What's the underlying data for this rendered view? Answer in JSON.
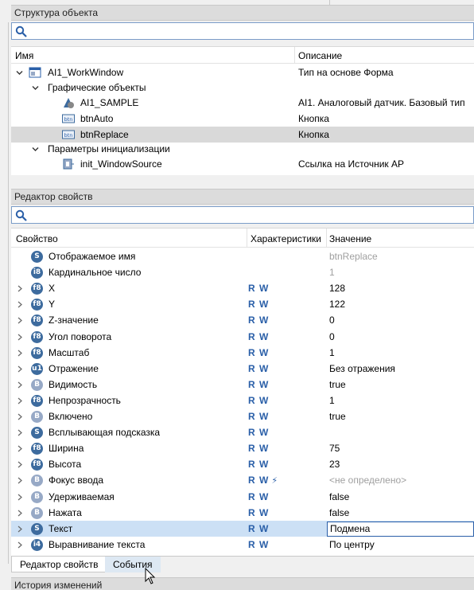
{
  "object_structure": {
    "title": "Структура объекта",
    "columns": {
      "name": "Имя",
      "description": "Описание"
    },
    "rows": [
      {
        "name": "AI1_WorkWindow",
        "desc": "Тип на основе Форма",
        "icon": "window-icon"
      },
      {
        "name": "Графические объекты",
        "desc": "",
        "icon": ""
      },
      {
        "name": "AI1_SAMPLE",
        "desc": "AI1. Аналоговый датчик. Базовый тип",
        "icon": "sensor-icon"
      },
      {
        "name": "btnAuto",
        "desc": "Кнопка",
        "icon": "button-icon",
        "icon_text": "btn"
      },
      {
        "name": "btnReplace",
        "desc": "Кнопка",
        "icon": "button-icon",
        "icon_text": "btn"
      },
      {
        "name": "Параметры инициализации",
        "desc": "",
        "icon": ""
      },
      {
        "name": "init_WindowSource",
        "desc": "Ссылка на Источник АР",
        "icon": "link-param-icon"
      }
    ]
  },
  "property_editor": {
    "title": "Редактор свойств",
    "columns": {
      "property": "Свойство",
      "characteristics": "Характеристики",
      "value": "Значение"
    },
    "rows": [
      {
        "badge": "S",
        "name": "Отображаемое имя",
        "rw": "",
        "value": "btnReplace"
      },
      {
        "badge": "i8",
        "name": "Кардинальное число",
        "rw": "",
        "value": "1"
      },
      {
        "badge": "f8",
        "name": "X",
        "rw": "R W",
        "value": "128"
      },
      {
        "badge": "f8",
        "name": "Y",
        "rw": "R W",
        "value": "122"
      },
      {
        "badge": "f8",
        "name": "Z-значение",
        "rw": "R W",
        "value": "0"
      },
      {
        "badge": "f8",
        "name": "Угол поворота",
        "rw": "R W",
        "value": "0"
      },
      {
        "badge": "f8",
        "name": "Масштаб",
        "rw": "R W",
        "value": "1"
      },
      {
        "badge": "u1",
        "name": "Отражение",
        "rw": "R W",
        "value": "Без отражения"
      },
      {
        "badge": "B",
        "name": "Видимость",
        "rw": "R W",
        "value": "true"
      },
      {
        "badge": "f8",
        "name": "Непрозрачность",
        "rw": "R W",
        "value": "1"
      },
      {
        "badge": "B",
        "name": "Включено",
        "rw": "R W",
        "value": "true"
      },
      {
        "badge": "S",
        "name": "Всплывающая подсказка",
        "rw": "R W",
        "value": ""
      },
      {
        "badge": "f8",
        "name": "Ширина",
        "rw": "R W",
        "value": "75"
      },
      {
        "badge": "f8",
        "name": "Высота",
        "rw": "R W",
        "value": "23"
      },
      {
        "badge": "B",
        "name": "Фокус ввода",
        "rw": "R W",
        "value": "<не определено>"
      },
      {
        "badge": "B",
        "name": "Удерживаемая",
        "rw": "R W",
        "value": "false"
      },
      {
        "badge": "B",
        "name": "Нажата",
        "rw": "R W",
        "value": "false"
      },
      {
        "badge": "S",
        "name": "Текст",
        "rw": "R W",
        "value": "Подмена"
      },
      {
        "badge": "i4",
        "name": "Выравнивание текста",
        "rw": "R W",
        "value": "По центру"
      }
    ]
  },
  "tabs": {
    "properties": "Редактор свойств",
    "events": "События"
  },
  "history": {
    "title": "История изменений"
  },
  "colors": {
    "accent": "#2a5fa8",
    "badge_dark": "#3d6b9e",
    "badge_light": "#97a9c6",
    "selection": "#cce0f5"
  }
}
